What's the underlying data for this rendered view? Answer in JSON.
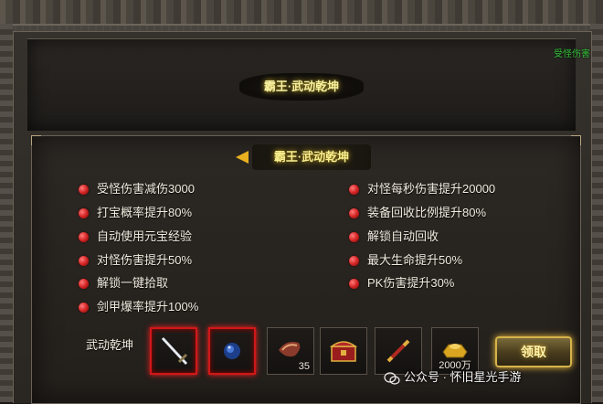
{
  "header": {
    "title": "霸王·武动乾坤",
    "status_tag": "受怪伤害"
  },
  "panel": {
    "title": "霸王·武动乾坤"
  },
  "attributes_left": [
    "受怪伤害减伤3000",
    "打宝概率提升80%",
    "自动使用元宝经验",
    "对怪伤害提升50%",
    "解锁一键拾取",
    "剑甲爆率提升100%"
  ],
  "attributes_right": [
    "对怪每秒伤害提升20000",
    "装备回收比例提升80%",
    "解锁自动回收",
    "最大生命提升50%",
    "PK伤害提升30%"
  ],
  "rewards": {
    "label": "武动乾坤",
    "items": [
      {
        "icon": "sword-icon",
        "count": ""
      },
      {
        "icon": "blue-orb-icon",
        "count": ""
      },
      {
        "icon": "bracer-icon",
        "count": "35"
      },
      {
        "icon": "treasure-chest-icon",
        "count": ""
      },
      {
        "icon": "flute-icon",
        "count": ""
      },
      {
        "icon": "gold-ingot-icon",
        "count": "2000万"
      }
    ]
  },
  "claim_button": "领取",
  "watermark": "公众号 · 怀旧星光手游",
  "colors": {
    "accent_gold": "#f7ef90",
    "bullet_red": "#d42525",
    "status_green": "#34c23a"
  }
}
